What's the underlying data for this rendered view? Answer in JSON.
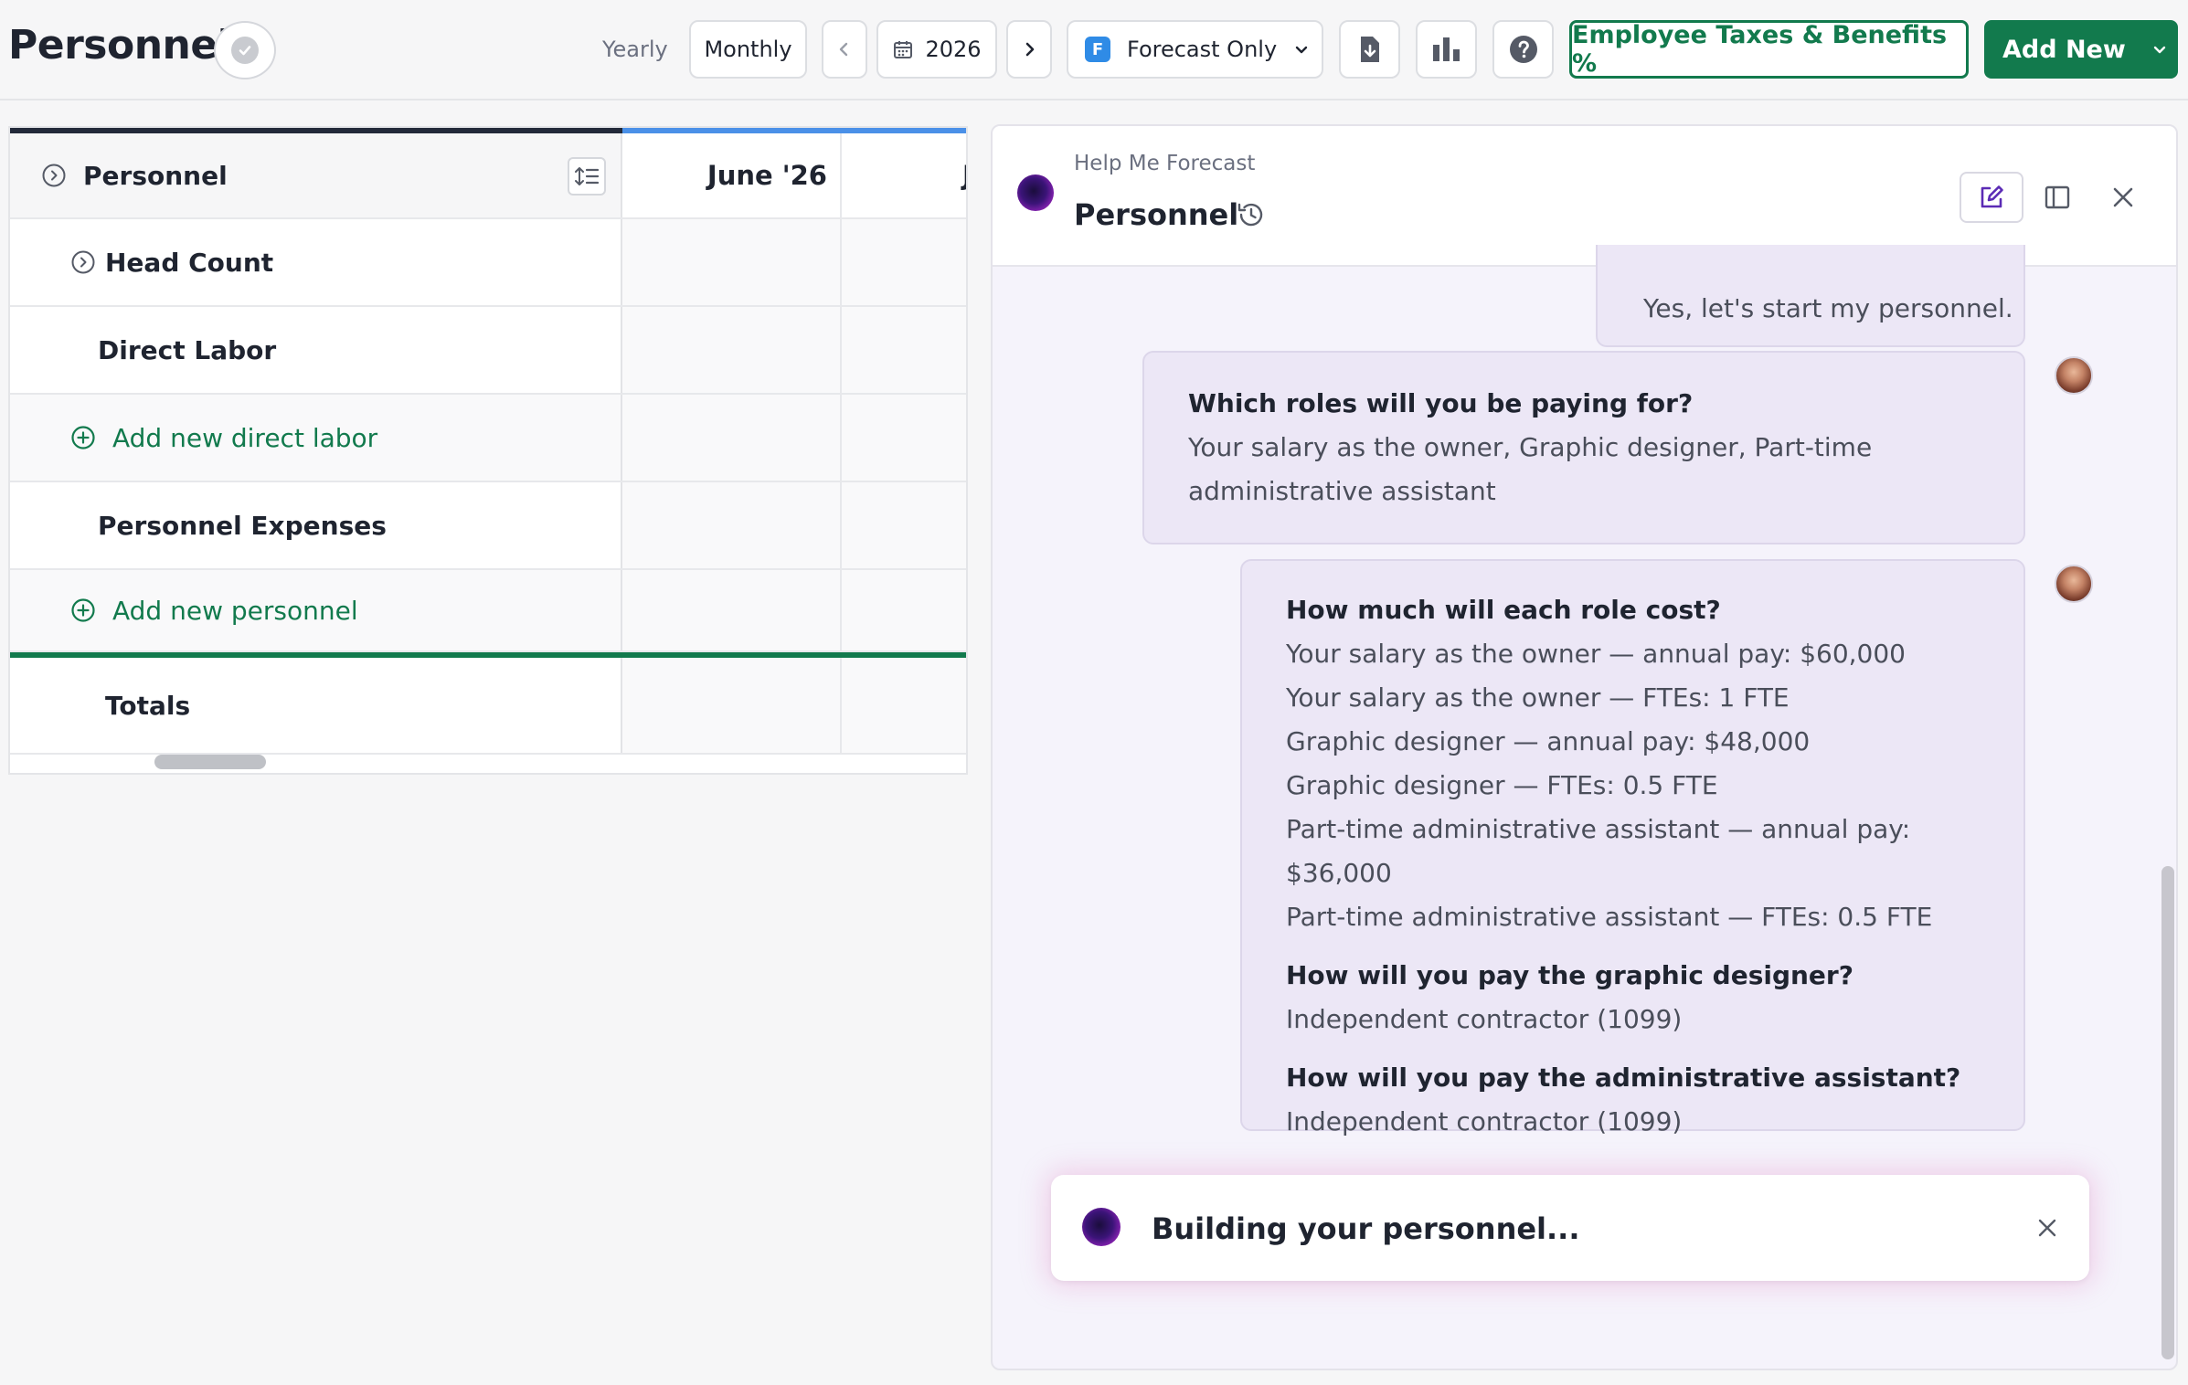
{
  "header": {
    "title": "Personnel",
    "view_yearly": "Yearly",
    "view_monthly": "Monthly",
    "year": "2026",
    "scenario_badge": "F",
    "scenario": "Forecast Only",
    "taxes_button": "Employee Taxes & Benefits %",
    "add_new_button": "Add New"
  },
  "grid": {
    "header_label": "Personnel",
    "month_1": "June '26",
    "month_2": "J",
    "rows": {
      "head_count": "Head Count",
      "direct_labor": "Direct Labor",
      "add_direct_labor": "Add new direct labor",
      "personnel_expenses": "Personnel Expenses",
      "add_personnel": "Add new personnel",
      "totals": "Totals"
    }
  },
  "chat": {
    "subtitle": "Help Me Forecast",
    "title": "Personnel",
    "user_reply": "Yes, let's start my personnel.",
    "q1": {
      "question": "Which roles will you be paying for?",
      "answer_line_1": "Your salary as the owner, Graphic designer, Part-time",
      "answer_line_2": "administrative assistant"
    },
    "q2": {
      "question": "How much will each role cost?",
      "lines": [
        "Your salary as the owner — annual pay: $60,000",
        "Your salary as the owner — FTEs: 1 FTE",
        "Graphic designer — annual pay: $48,000",
        "Graphic designer — FTEs: 0.5 FTE",
        "Part-time administrative assistant — annual pay: $36,000",
        "Part-time administrative assistant — FTEs: 0.5 FTE"
      ],
      "question_2": "How will you pay the graphic designer?",
      "answer_2": "Independent contractor (1099)",
      "question_3": "How will you pay the administrative assistant?",
      "answer_3": "Independent contractor (1099)"
    },
    "toast": "Building your personnel..."
  },
  "colors": {
    "brand_green": "#127a4d",
    "accent_blue": "#4a90e8",
    "bubble_bg": "#ece7f6"
  }
}
